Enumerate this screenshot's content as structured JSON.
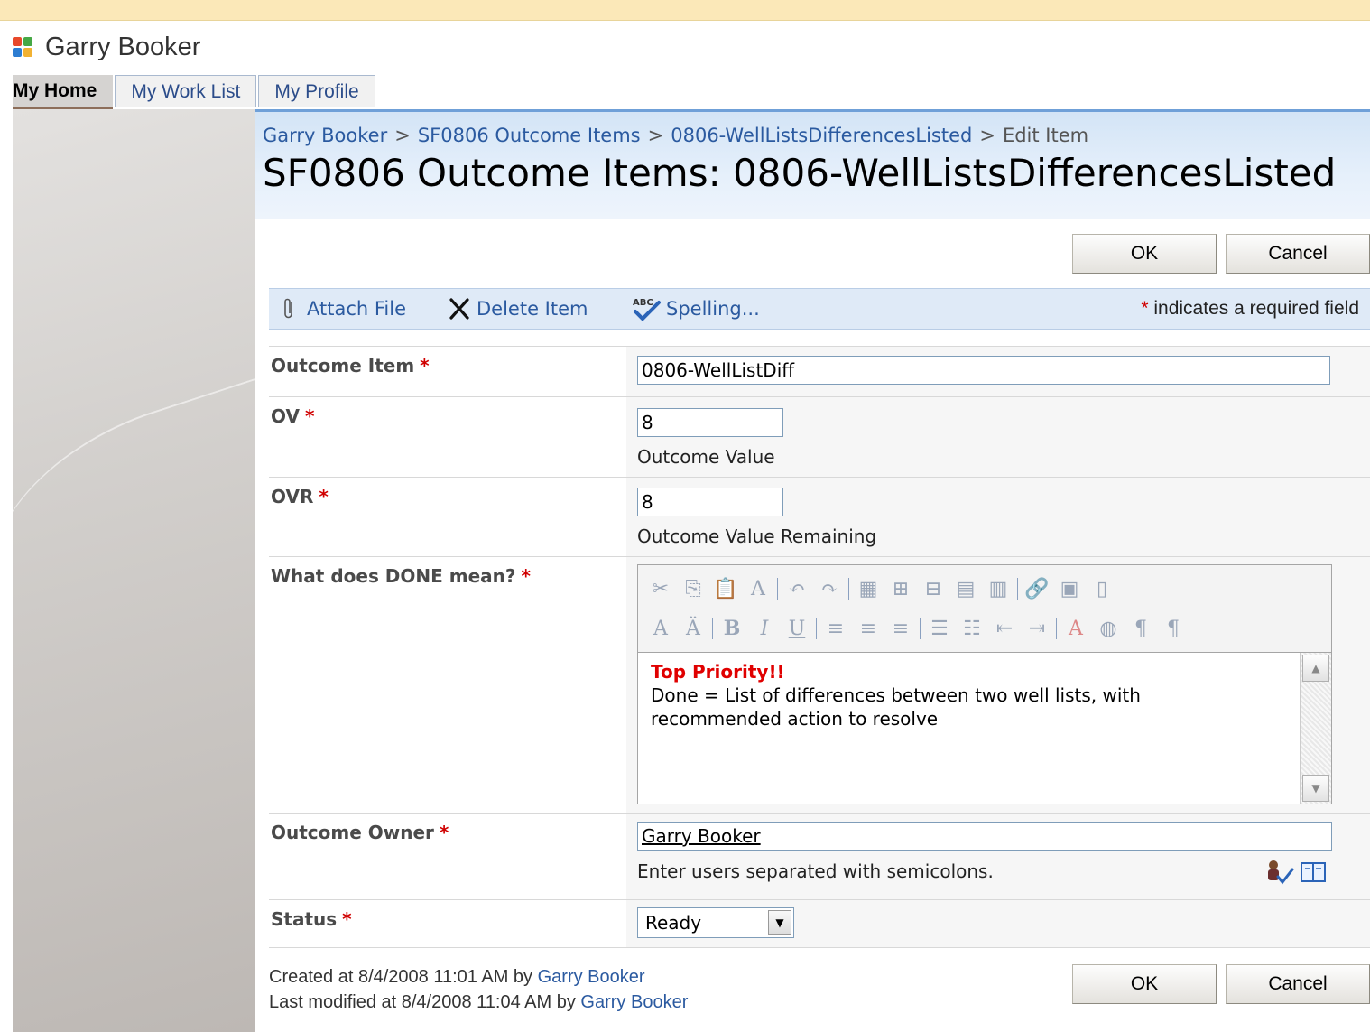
{
  "site": {
    "title": "Garry Booker",
    "colors": {
      "brand_blue": "#2b5aa0",
      "required_red": "#d00000"
    }
  },
  "tabs": [
    {
      "label": "My Home",
      "selected": true
    },
    {
      "label": "My Work List",
      "selected": false
    },
    {
      "label": "My Profile",
      "selected": false
    }
  ],
  "breadcrumb": {
    "items": [
      "Garry Booker",
      "SF0806 Outcome Items",
      "0806-WellListsDifferencesListed",
      "Edit Item"
    ],
    "separator": ">"
  },
  "page_title": "SF0806 Outcome Items: 0806-WellListsDifferencesListed",
  "buttons": {
    "ok": "OK",
    "cancel": "Cancel"
  },
  "toolbar": {
    "attach": {
      "label": "Attach File",
      "icon": "paperclip-icon"
    },
    "delete": {
      "label": "Delete Item",
      "icon": "delete-x-icon"
    },
    "spelling": {
      "label": "Spelling...",
      "icon": "spellcheck-icon"
    },
    "required_star": "*",
    "required_note": "indicates a required field"
  },
  "form": {
    "required_star": "*",
    "outcome_item": {
      "label": "Outcome Item",
      "value": "0806-WellListDiff"
    },
    "ov": {
      "label": "OV",
      "value": "8",
      "description": "Outcome Value"
    },
    "ovr": {
      "label": "OVR",
      "value": "8",
      "description": "Outcome Value Remaining"
    },
    "done": {
      "label": "What does DONE mean?",
      "priority": "Top Priority!!",
      "line1": "Done = List of differences between two well lists, with",
      "line2": "recommended action to resolve"
    },
    "owner": {
      "label": "Outcome Owner",
      "value": "Garry Booker",
      "hint": "Enter users separated with semicolons."
    },
    "status": {
      "label": "Status",
      "value": "Ready"
    }
  },
  "footer": {
    "created_prefix": "Created at 8/4/2008 11:01 AM  by",
    "created_by": "Garry Booker",
    "modified_prefix": "Last modified at 8/4/2008 11:04 AM  by",
    "modified_by": "Garry Booker"
  }
}
